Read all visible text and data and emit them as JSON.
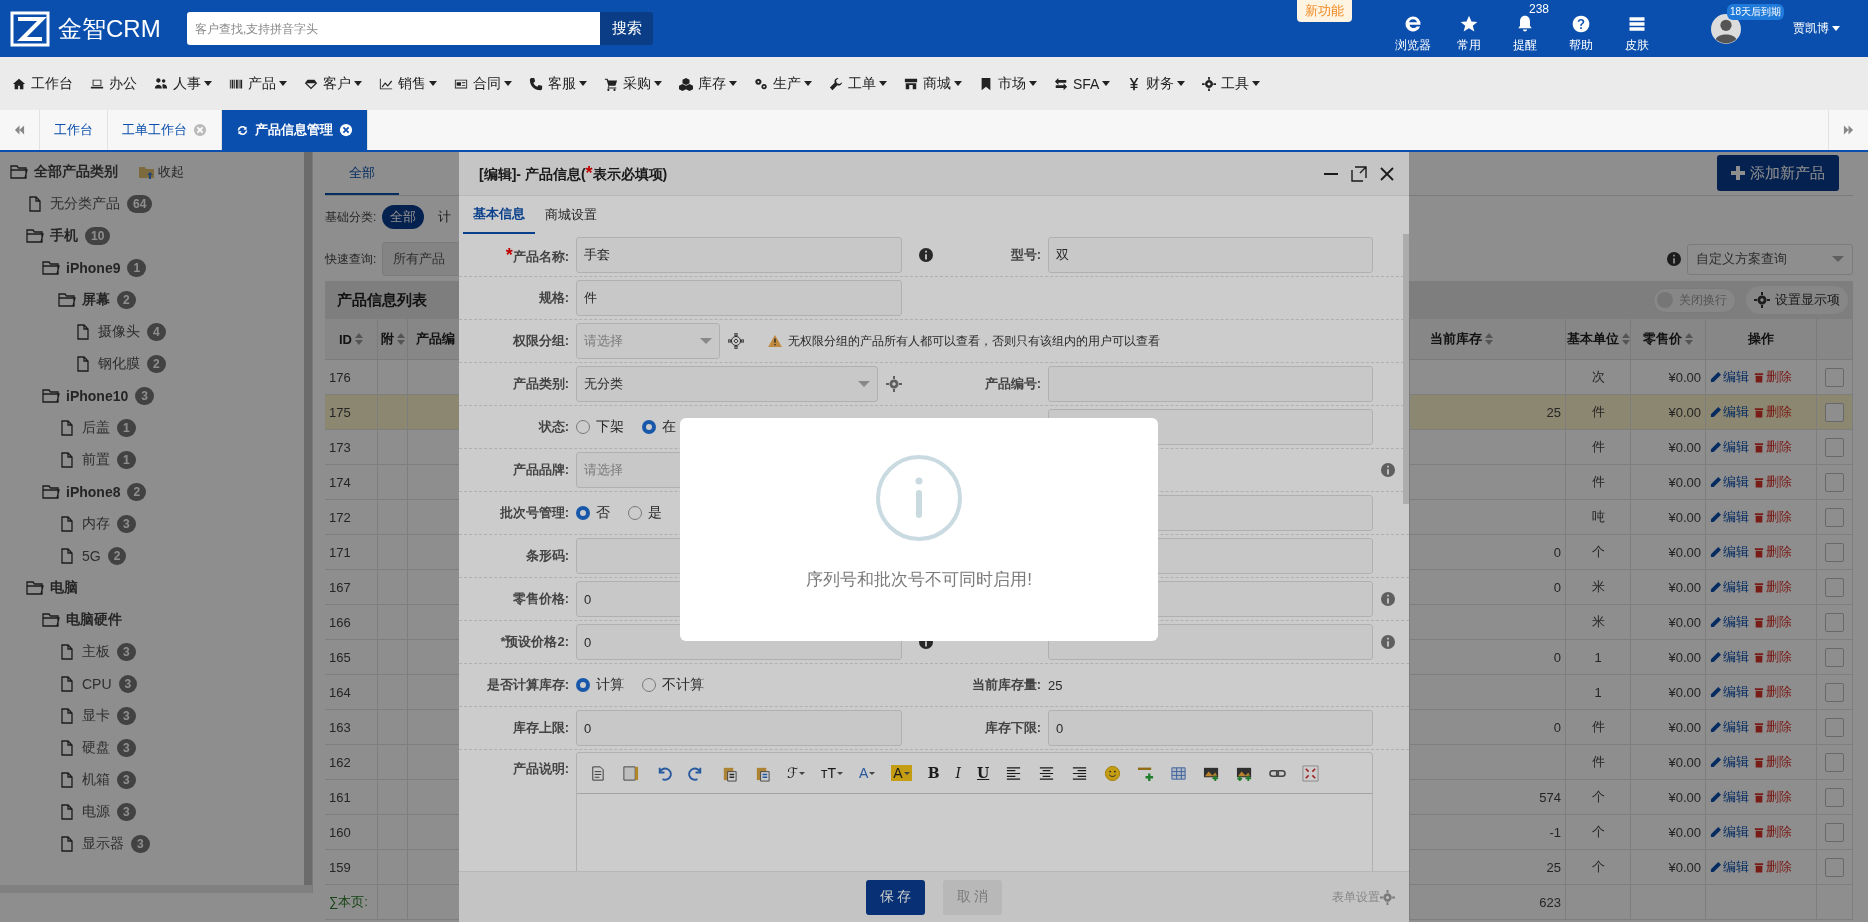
{
  "header": {
    "logo": "金智CRM",
    "search": {
      "placeholder": "客户查找,支持拼音字头",
      "button": "搜索"
    },
    "new_badge": "新功能",
    "tools": [
      {
        "kind": "browser",
        "label": "浏览器"
      },
      {
        "kind": "star",
        "label": "常用"
      },
      {
        "kind": "bell",
        "label": "提醒",
        "badge": "238"
      },
      {
        "kind": "help",
        "label": "帮助"
      },
      {
        "kind": "skin",
        "label": "皮肤"
      }
    ],
    "user": {
      "expiry_badge": "18天后到期",
      "name": "贾凯博",
      "dropdown": true
    }
  },
  "nav": [
    {
      "kind": "home",
      "label": "工作台",
      "dropdown": false
    },
    {
      "kind": "laptop",
      "label": "办公",
      "dropdown": false
    },
    {
      "kind": "users",
      "label": "人事",
      "dropdown": true
    },
    {
      "kind": "barcode",
      "label": "产品",
      "dropdown": true
    },
    {
      "kind": "diamond",
      "label": "客户",
      "dropdown": true
    },
    {
      "kind": "chart",
      "label": "销售",
      "dropdown": true
    },
    {
      "kind": "card",
      "label": "合同",
      "dropdown": true
    },
    {
      "kind": "phone",
      "label": "客服",
      "dropdown": true
    },
    {
      "kind": "cart",
      "label": "采购",
      "dropdown": true
    },
    {
      "kind": "cubes",
      "label": "库存",
      "dropdown": true
    },
    {
      "kind": "gears",
      "label": "生产",
      "dropdown": true
    },
    {
      "kind": "wrench",
      "label": "工单",
      "dropdown": true
    },
    {
      "kind": "shop",
      "label": "商城",
      "dropdown": true
    },
    {
      "kind": "bookmark",
      "label": "市场",
      "dropdown": true
    },
    {
      "kind": "exchange",
      "label": "SFA",
      "dropdown": true
    },
    {
      "kind": "yen",
      "label": "财务",
      "dropdown": true
    },
    {
      "kind": "gear",
      "label": "工具",
      "dropdown": true
    }
  ],
  "page_tabs": [
    {
      "label": "工作台",
      "selected": false,
      "refresh": false,
      "closable": false
    },
    {
      "label": "工单工作台",
      "selected": false,
      "refresh": false,
      "closable": true
    },
    {
      "label": "产品信息管理",
      "selected": true,
      "refresh": true,
      "closable": true
    }
  ],
  "tree": {
    "title": "全部产品类别",
    "collapse": "收起",
    "items": [
      {
        "label": "无分类产品",
        "count": "64"
      },
      {
        "label": "手机",
        "count": "10",
        "children": [
          {
            "label": "iPhone9",
            "count": "1",
            "children": [
              {
                "label": "屏幕",
                "count": "2",
                "children": [
                  {
                    "label": "摄像头",
                    "count": "4"
                  },
                  {
                    "label": "钢化膜",
                    "count": "2"
                  }
                ]
              }
            ]
          },
          {
            "label": "iPhone10",
            "count": "3",
            "children": [
              {
                "label": "后盖",
                "count": "1"
              },
              {
                "label": "前置",
                "count": "1"
              }
            ]
          },
          {
            "label": "iPhone8",
            "count": "2",
            "children": [
              {
                "label": "内存",
                "count": "3"
              },
              {
                "label": "5G",
                "count": "2"
              }
            ]
          }
        ]
      },
      {
        "label": "电脑",
        "children": [
          {
            "label": "电脑硬件",
            "children": [
              {
                "label": "主板",
                "count": "3"
              },
              {
                "label": "CPU",
                "count": "3"
              },
              {
                "label": "显卡",
                "count": "3"
              },
              {
                "label": "硬盘",
                "count": "3"
              },
              {
                "label": "机箱",
                "count": "3"
              },
              {
                "label": "电源",
                "count": "3"
              },
              {
                "label": "显示器",
                "count": "3"
              }
            ]
          }
        ]
      }
    ]
  },
  "content": {
    "tabs": [
      {
        "label": "全部",
        "selected": true
      }
    ],
    "add_button": "添加新产品",
    "filters": {
      "category_label": "基础分类:",
      "chips": [
        {
          "label": "全部",
          "selected": true
        },
        {
          "label": "计",
          "selected": false
        }
      ],
      "quick_label": "快速查询:",
      "quick_value": "所有产品",
      "scheme_placeholder": "自定义方案查询"
    },
    "table": {
      "title": "产品信息列表",
      "wrap_toggle": {
        "label": "关闭换行",
        "on": false
      },
      "settings_button": "设置显示项",
      "columns": [
        {
          "label": "ID",
          "sortable": true
        },
        {
          "label": "附",
          "sortable": true
        },
        {
          "label": "产品编"
        },
        {
          "label": "当前库存",
          "sortable": true
        },
        {
          "label": "基本单位",
          "sortable": true
        },
        {
          "label": "零售价",
          "sortable": true
        },
        {
          "label": "操作",
          "sortable": false
        }
      ],
      "rows": [
        {
          "id": "176",
          "unit": "次",
          "price": "¥0.00",
          "edit": "编辑",
          "delete": "删除",
          "highlighted": false,
          "checked": false
        },
        {
          "id": "175",
          "stock": "25",
          "unit": "件",
          "price": "¥0.00",
          "edit": "编辑",
          "delete": "删除",
          "highlighted": true,
          "checked": false
        },
        {
          "id": "173",
          "unit": "件",
          "price": "¥0.00",
          "edit": "编辑",
          "delete": "删除",
          "highlighted": false,
          "checked": false
        },
        {
          "id": "174",
          "unit": "件",
          "price": "¥0.00",
          "edit": "编辑",
          "delete": "删除",
          "highlighted": false,
          "checked": false
        },
        {
          "id": "172",
          "unit": "吨",
          "price": "¥0.00",
          "edit": "编辑",
          "delete": "删除",
          "highlighted": false,
          "checked": false
        },
        {
          "id": "171",
          "stock": "0",
          "unit": "个",
          "price": "¥0.00",
          "edit": "编辑",
          "delete": "删除",
          "highlighted": false,
          "checked": false
        },
        {
          "id": "167",
          "stock": "0",
          "unit": "米",
          "price": "¥0.00",
          "edit": "编辑",
          "delete": "删除",
          "highlighted": false,
          "checked": false
        },
        {
          "id": "166",
          "unit": "米",
          "price": "¥0.00",
          "edit": "编辑",
          "delete": "删除",
          "highlighted": false,
          "checked": false
        },
        {
          "id": "165",
          "stock": "0",
          "unit": "1",
          "price": "¥0.00",
          "edit": "编辑",
          "delete": "删除",
          "highlighted": false,
          "checked": false
        },
        {
          "id": "164",
          "unit": "1",
          "price": "¥0.00",
          "edit": "编辑",
          "delete": "删除",
          "highlighted": false,
          "checked": false
        },
        {
          "id": "163",
          "stock": "0",
          "unit": "件",
          "price": "¥0.00",
          "edit": "编辑",
          "delete": "删除",
          "highlighted": false,
          "checked": false
        },
        {
          "id": "162",
          "unit": "件",
          "price": "¥0.00",
          "edit": "编辑",
          "delete": "删除",
          "highlighted": false,
          "checked": false
        },
        {
          "id": "161",
          "stock": "574",
          "unit": "个",
          "price": "¥0.00",
          "edit": "编辑",
          "delete": "删除",
          "highlighted": false,
          "checked": false
        },
        {
          "id": "160",
          "stock": "-1",
          "unit": "个",
          "price": "¥0.00",
          "edit": "编辑",
          "delete": "删除",
          "highlighted": false,
          "checked": false
        },
        {
          "id": "159",
          "stock": "25",
          "unit": "个",
          "price": "¥0.00",
          "edit": "编辑",
          "delete": "删除",
          "highlighted": false,
          "checked": false
        }
      ],
      "summary": {
        "label": "∑本页:",
        "stock": "623"
      }
    }
  },
  "modal": {
    "title": "[编辑]- 产品信息(",
    "required_mark": "*",
    "title_end": "表示必填项)",
    "tabs": [
      {
        "label": "基本信息",
        "selected": true
      },
      {
        "label": "商城设置",
        "selected": false
      }
    ],
    "rows": [
      {
        "kind": "pair",
        "left": {
          "label": "产品名称:",
          "mark": "*",
          "kind": "input",
          "value": "手套",
          "info": true
        },
        "right": {
          "label": "型号:",
          "kind": "input",
          "value": "双"
        }
      },
      {
        "kind": "pair",
        "left": {
          "label": "规格:",
          "kind": "input",
          "value": "件"
        }
      },
      {
        "kind": "wide",
        "left": {
          "label": "权限分组:",
          "kind": "select",
          "placeholder": "请选择",
          "gear": {
            "kind": "outline"
          }
        },
        "warning": "无权限分组的产品所有人都可以查看，否则只有该组内的用户可以查看"
      },
      {
        "kind": "pair",
        "left": {
          "label": "产品类别:",
          "kind": "select",
          "value": "无分类",
          "gear": {
            "kind": "solid"
          }
        },
        "right": {
          "label": "产品编号:",
          "kind": "input"
        }
      },
      {
        "kind": "pair",
        "left": {
          "label": "状态:",
          "kind": "radio",
          "options": [
            {
              "label": "下架",
              "selected": false
            },
            {
              "label": "在",
              "selected": true
            }
          ]
        },
        "right": {
          "kind": "input"
        }
      },
      {
        "kind": "pair",
        "left": {
          "label": "产品品牌:",
          "kind": "select",
          "placeholder": "请选择"
        },
        "right": {
          "info": true
        }
      },
      {
        "kind": "pair",
        "left": {
          "label": "批次号管理:",
          "kind": "radio",
          "options": [
            {
              "label": "否",
              "selected": true
            },
            {
              "label": "是",
              "selected": false
            }
          ]
        },
        "right": {
          "kind": "input"
        }
      },
      {
        "kind": "pair",
        "left": {
          "label": "条形码:",
          "kind": "input"
        },
        "right": {
          "kind": "input"
        }
      },
      {
        "kind": "pair",
        "left": {
          "label": "零售价格:",
          "kind": "input",
          "value": "0"
        },
        "right": {
          "kind": "input",
          "info": true
        }
      },
      {
        "kind": "pair",
        "left": {
          "label": "*预设价格2:",
          "kind": "input",
          "value": "0",
          "info": true
        },
        "right": {
          "kind": "input",
          "info": true
        }
      },
      {
        "kind": "pair",
        "left": {
          "label": "是否计算库存:",
          "kind": "radio",
          "options": [
            {
              "label": "计算",
              "selected": true
            },
            {
              "label": "不计算",
              "selected": false
            }
          ]
        },
        "right": {
          "label": "当前库存量:",
          "kind": "text",
          "value": "25"
        }
      },
      {
        "kind": "pair",
        "left": {
          "label": "库存上限:",
          "kind": "input",
          "value": "0"
        },
        "right": {
          "label": "库存下限:",
          "kind": "input",
          "value": "0"
        }
      }
    ],
    "editor": {
      "label": "产品说明:",
      "toolbar": [
        {
          "kind": "doc"
        },
        {
          "kind": "template"
        },
        {
          "kind": "undo"
        },
        {
          "kind": "redo"
        },
        {
          "kind": "paste_text"
        },
        {
          "kind": "paste_word"
        },
        {
          "kind": "glyph",
          "glyph": "ℱ",
          "menu": true
        },
        {
          "kind": "glyph",
          "glyph": "тT",
          "menu": true
        },
        {
          "kind": "color",
          "glyph": "A",
          "menu": true
        },
        {
          "kind": "highlight",
          "glyph": "A",
          "menu": true
        },
        {
          "kind": "bold",
          "glyph": "B"
        },
        {
          "kind": "italic",
          "glyph": "I"
        },
        {
          "kind": "underline",
          "glyph": "U"
        },
        {
          "kind": "align_left"
        },
        {
          "kind": "align_center"
        },
        {
          "kind": "align_right"
        },
        {
          "kind": "emoji"
        },
        {
          "kind": "hr"
        },
        {
          "kind": "table"
        },
        {
          "kind": "image"
        },
        {
          "kind": "gallery"
        },
        {
          "kind": "link"
        },
        {
          "kind": "fullscreen"
        }
      ]
    },
    "save": "保 存",
    "cancel": "取 消",
    "form_settings": "表单设置"
  },
  "alert": {
    "message": "序列号和批次号不可同时启用!"
  }
}
